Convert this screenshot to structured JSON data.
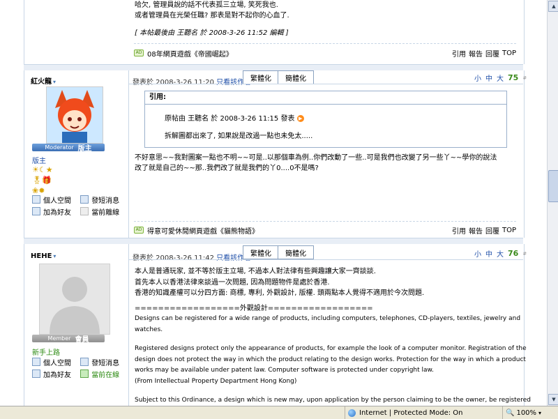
{
  "top_post": {
    "lines": [
      "哈欠, 管理員說的話不代表孤三立場, 笑死我也.",
      "或者管理員在光榮任職? 那表是對不起你的心血了."
    ],
    "edit_note": "[ 本帖最後由 王聽名 於 2008-3-26 11:52 編輯 ]",
    "signature": "08年網頁遊戲《帝國崛起》",
    "actions": [
      "引用",
      "報告",
      "回覆",
      "TOP"
    ]
  },
  "post1": {
    "author": "紅火龍",
    "rank_en": "Moderator",
    "rank_zh": "版主",
    "group": "版主",
    "meta": "發表於 2008-3-26 11:20",
    "only_author": "只看該作者",
    "tab_trad": "繁體化",
    "tab_simp": "簡體化",
    "font_sizes": [
      "小",
      "中",
      "大"
    ],
    "floor": "75",
    "floor_mark": "#",
    "quote_label": "引用:",
    "quote_meta": "原帖由  王聽名 於 2008-3-26 11:15 發表",
    "quote_text": "拆解圖都出來了, 如果說是改過一點也未免太.....",
    "body": [
      "不好意思~~我對圖案一點也不明~~可是..以那個車為例..你們改動了一些..可是我們也改變了另一些丫~~學你的說法",
      "改了就是自己的~~那..我們改了就是我們的丫0....0不是嗎?"
    ],
    "links": [
      "個人空間",
      "發短消息",
      "加為好友",
      "當前離線"
    ],
    "signature": "得意可愛休閒網頁遊戲《貓熊物語》",
    "actions": [
      "引用",
      "報告",
      "回覆",
      "TOP"
    ]
  },
  "post2": {
    "author": "HEHE",
    "rank_en": "Member",
    "rank_zh": "會員",
    "group": "新手上路",
    "meta": "發表於 2008-3-26 11:42",
    "only_author": "只看該作者",
    "tab_trad": "繁體化",
    "tab_simp": "簡體化",
    "font_sizes": [
      "小",
      "中",
      "大"
    ],
    "floor": "76",
    "floor_mark": "#",
    "body": [
      "本人是普通玩家, 並不等於版主立場, 不過本人對法律有些興趣讓大家一齊談談.",
      "首先本人以香港法律來談過一次問題, 因為問題物件是處於香港.",
      "香港的知識產權可以分四方面: 商標, 專利, 外觀設計, 版權. 頭兩點本人覺得不適用於今次問題.",
      "",
      "==================外觀設計==================",
      "Designs can be registered for a wide range of products, including computers, telephones, CD-players, textiles, jewelry and",
      "watches.",
      "",
      "Registered designs protect only the appearance of products, for example the look of a computer monitor. Registration of the",
      "design does not protect the way in which the product relating to the design works. Protection for the way in which a product",
      "works may be available under patent law. Computer software is protected under copyright law.",
      "(From Intellectual Property Department Hong Kong)",
      "",
      "Subject to this Ordinance, a design which is new may, upon application by the person claiming to be the owner, be registered"
    ],
    "links": [
      "個人空間",
      "發短消息",
      "加為好友",
      "當前在線"
    ]
  },
  "statusbar": {
    "zone": "Internet | Protected Mode: On",
    "zoom": "100%"
  },
  "colors": {
    "link": "#1f4fa8",
    "online": "#2c8a12",
    "border": "#c8d6e6"
  }
}
